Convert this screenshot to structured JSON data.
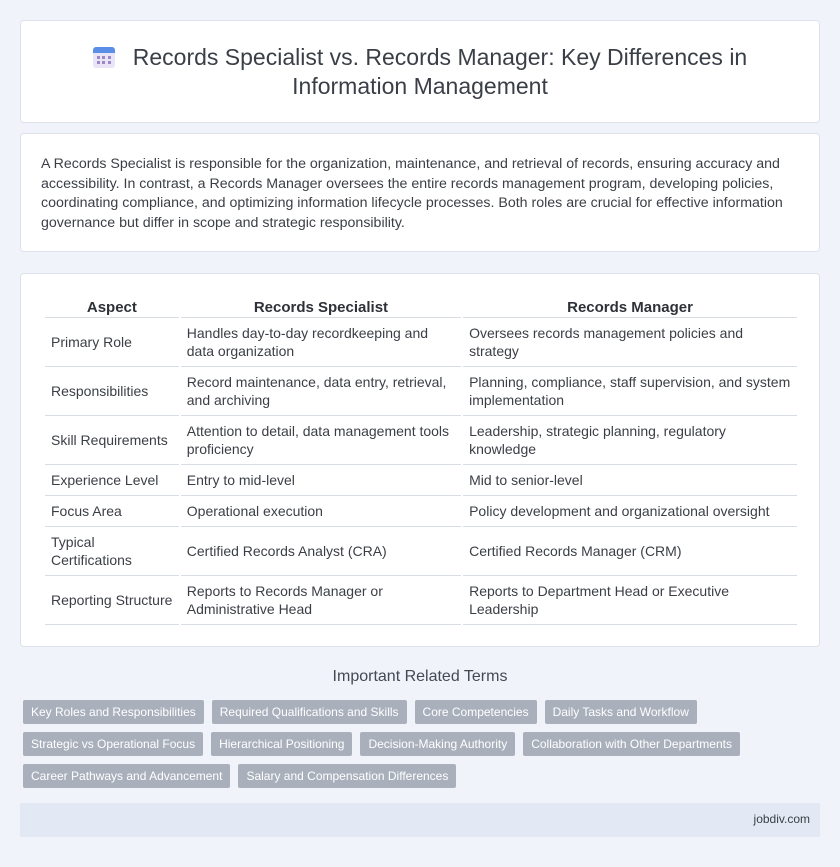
{
  "header": {
    "icon": "calendar-icon",
    "title": "Records Specialist vs. Records Manager: Key Differences in Information Management"
  },
  "intro": {
    "text": "A Records Specialist is responsible for the organization, maintenance, and retrieval of records, ensuring accuracy and accessibility. In contrast, a Records Manager oversees the entire records management program, developing policies, coordinating compliance, and optimizing information lifecycle processes. Both roles are crucial for effective information governance but differ in scope and strategic responsibility."
  },
  "table": {
    "headers": [
      "Aspect",
      "Records Specialist",
      "Records Manager"
    ],
    "rows": [
      [
        "Primary Role",
        "Handles day-to-day recordkeeping and data organization",
        "Oversees records management policies and strategy"
      ],
      [
        "Responsibilities",
        "Record maintenance, data entry, retrieval, and archiving",
        "Planning, compliance, staff supervision, and system implementation"
      ],
      [
        "Skill Requirements",
        "Attention to detail, data management tools proficiency",
        "Leadership, strategic planning, regulatory knowledge"
      ],
      [
        "Experience Level",
        "Entry to mid-level",
        "Mid to senior-level"
      ],
      [
        "Focus Area",
        "Operational execution",
        "Policy development and organizational oversight"
      ],
      [
        "Typical Certifications",
        "Certified Records Analyst (CRA)",
        "Certified Records Manager (CRM)"
      ],
      [
        "Reporting Structure",
        "Reports to Records Manager or Administrative Head",
        "Reports to Department Head or Executive Leadership"
      ]
    ]
  },
  "related": {
    "heading": "Important Related Terms",
    "rows": [
      [
        "Key Roles and Responsibilities",
        "Required Qualifications and Skills",
        "Core Competencies",
        "Daily Tasks and Workflow"
      ],
      [
        "Strategic vs Operational Focus",
        "Hierarchical Positioning",
        "Decision-Making Authority",
        "Collaboration with Other Departments"
      ],
      [
        "Career Pathways and Advancement",
        "Salary and Compensation Differences"
      ]
    ]
  },
  "footer": {
    "site": "jobdiv.com"
  },
  "colors": {
    "background": "#f0f3f9",
    "tag": "#a9b0bc",
    "footer": "#e2e8f4",
    "icon_accent": "#5b8ee6"
  }
}
